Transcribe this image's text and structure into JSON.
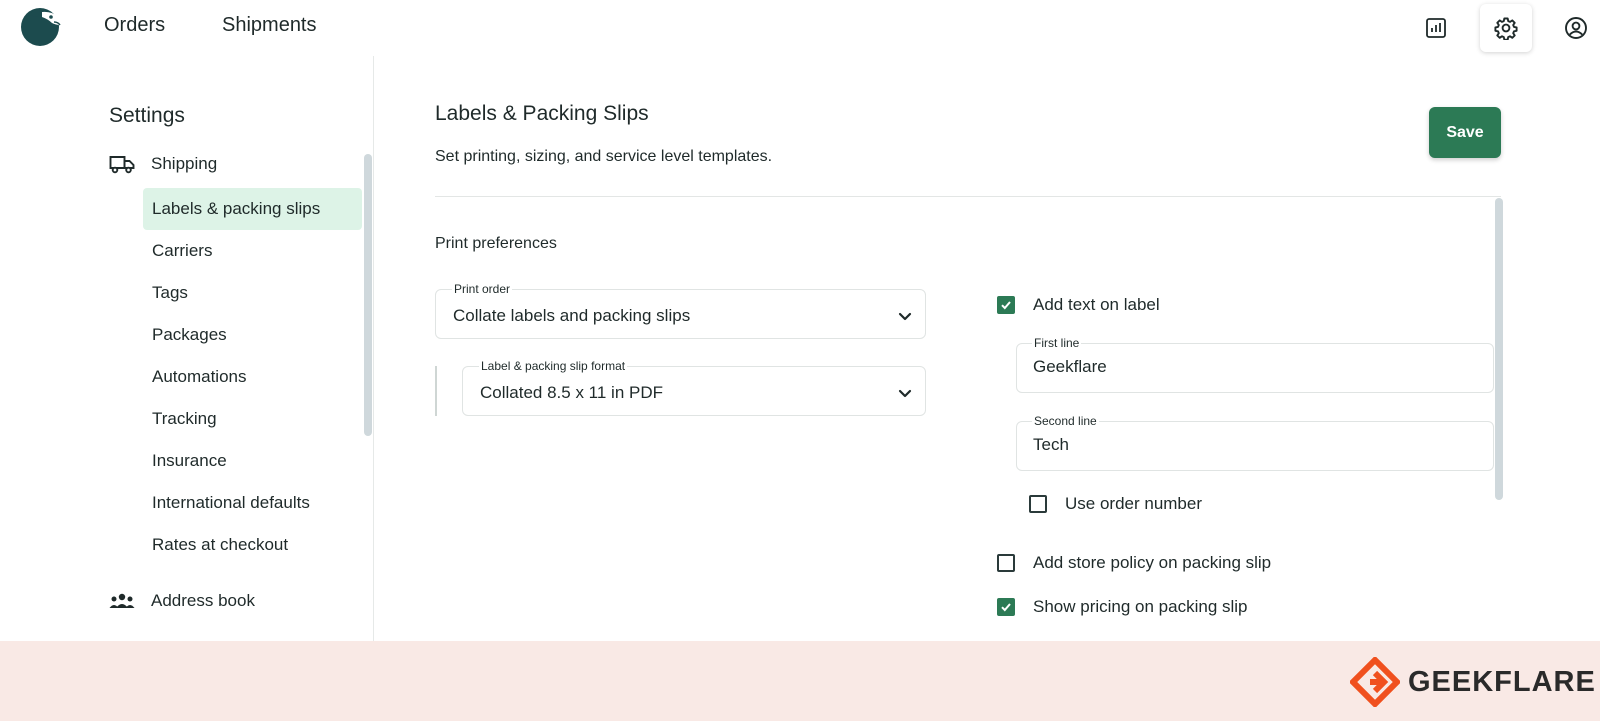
{
  "header": {
    "nav": [
      {
        "label": "Orders"
      },
      {
        "label": "Shipments"
      }
    ],
    "icons": [
      "reports-icon",
      "gear-icon",
      "account-icon"
    ]
  },
  "sidebar": {
    "title": "Settings",
    "sections": {
      "shipping": {
        "label": "Shipping",
        "icon": "truck-icon",
        "items": [
          {
            "label": "Labels & packing slips",
            "active": true
          },
          {
            "label": "Carriers"
          },
          {
            "label": "Tags"
          },
          {
            "label": "Packages"
          },
          {
            "label": "Automations"
          },
          {
            "label": "Tracking"
          },
          {
            "label": "Insurance"
          },
          {
            "label": "International defaults"
          },
          {
            "label": "Rates at checkout"
          }
        ]
      },
      "address_book": {
        "label": "Address book",
        "icon": "people-icon"
      }
    }
  },
  "main": {
    "title": "Labels & Packing Slips",
    "subtitle": "Set printing, sizing, and service level templates.",
    "save_label": "Save",
    "section_title": "Print preferences",
    "print_order": {
      "label": "Print order",
      "value": "Collate labels and packing slips"
    },
    "format": {
      "label": "Label & packing slip format",
      "value": "Collated 8.5 x 11 in PDF"
    },
    "add_text": {
      "label": "Add text on label",
      "checked": true
    },
    "first_line": {
      "label": "First line",
      "value": "Geekflare"
    },
    "second_line": {
      "label": "Second line",
      "value": "Tech"
    },
    "use_order_number": {
      "label": "Use order number",
      "checked": false
    },
    "store_policy": {
      "label": "Add store policy on packing slip",
      "checked": false
    },
    "show_pricing": {
      "label": "Show pricing on packing slip",
      "checked": true
    }
  },
  "footer": {
    "brand": "GEEKFLARE"
  },
  "colors": {
    "accent": "#2c7a55",
    "active_bg": "#ddf3e7",
    "text": "#1f2a2a",
    "footer_bg": "#f9e9e5",
    "brand_orange": "#f0501e"
  }
}
